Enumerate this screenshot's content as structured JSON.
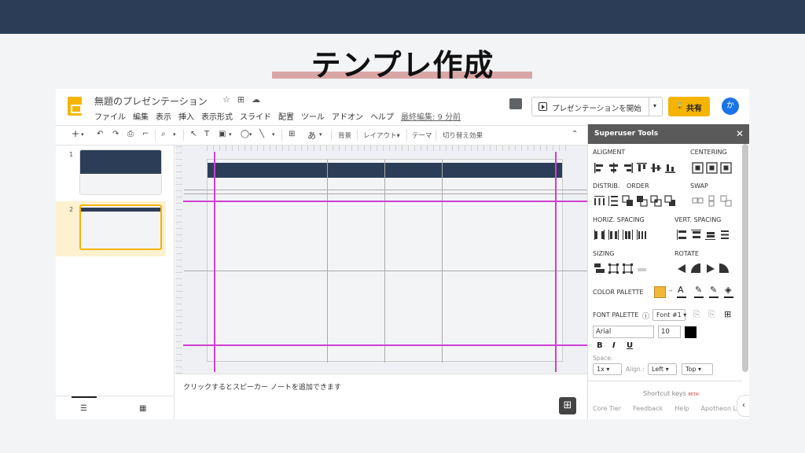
{
  "presentation": {
    "title": "テンプレ作成",
    "accent_color": "#d9a6a6",
    "band_color": "#2c3e57"
  },
  "app": {
    "doc_title": "無題のプレゼンテーション",
    "menu": [
      "ファイル",
      "編集",
      "表示",
      "挿入",
      "表示形式",
      "スライド",
      "配置",
      "ツール",
      "アドオン",
      "ヘルプ"
    ],
    "last_edit": "最終編集: 9 分前",
    "present_label": "プレゼンテーションを開始",
    "share_label": "共有",
    "avatar_initial": "か",
    "brand_color": "#f4b400"
  },
  "toolbar": {
    "background": "背景",
    "layout": "レイアウト▾",
    "theme": "テーマ",
    "transition": "切り替え効果"
  },
  "filmstrip": {
    "slides": [
      {
        "number": "1",
        "selected": false
      },
      {
        "number": "2",
        "selected": true
      }
    ]
  },
  "notes": {
    "placeholder": "クリックするとスピーカー ノートを追加できます"
  },
  "panel": {
    "title": "Superuser Tools",
    "close": "✕",
    "sections": {
      "alignment": "ALIGMENT",
      "centering": "CENTERING",
      "distrib": "DISTRIB.",
      "order": "ORDER",
      "swap": "SWAP",
      "horiz_spacing": "HORIZ. SPACING",
      "vert_spacing": "VERT. SPACING",
      "sizing": "SIZING",
      "rotate": "ROTATE",
      "color_palette": "COLOR PALETTE",
      "font_palette": "FONT PALETTE"
    },
    "color_palette_swatch": "#f0b73a",
    "font_preset": "Font #1",
    "font_name": "Arial",
    "font_size": "10",
    "bold": "B",
    "italic": "I",
    "underline": "U",
    "space_label": "Space:",
    "space_value": "1x",
    "align_label": "Align.:",
    "align_value": "Left",
    "valign_value": "Top",
    "shortcut_keys": "Shortcut keys",
    "beta": "BETA!",
    "footer_links": [
      "Core Tier",
      "Feedback",
      "Help",
      "Apotheon Labs"
    ]
  }
}
